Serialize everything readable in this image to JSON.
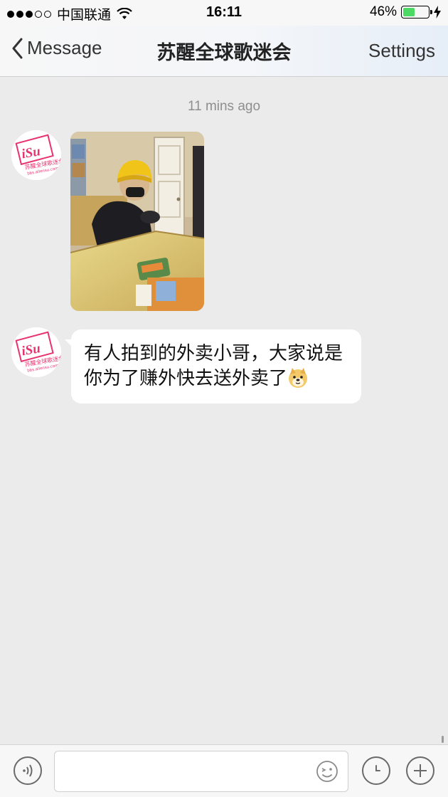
{
  "status_bar": {
    "carrier": "中国联通",
    "time": "16:11",
    "battery_percent_label": "46%",
    "battery_level": 0.46
  },
  "nav": {
    "back_label": "Message",
    "title": "苏醒全球歌迷会",
    "settings_label": "Settings"
  },
  "chat": {
    "timestamp": "11 mins ago",
    "messages": [
      {
        "type": "image",
        "sender_avatar": {
          "logo_text": "iSu",
          "sub_text": "苏醒全球歌迷会",
          "url_text": "bbs.allensu.com"
        }
      },
      {
        "type": "text",
        "sender_avatar": {
          "logo_text": "iSu",
          "sub_text": "苏醒全球歌迷会",
          "url_text": "bbs.allensu.com"
        },
        "line1": "有人拍到的外卖小哥，大家说是",
        "line2": "你为了赚外快去送外卖了",
        "emoji": "doge-emoji"
      }
    ]
  },
  "input_bar": {
    "text_value": "",
    "voice_icon": "voice-icon",
    "emoji_icon": "smiley-icon",
    "history_icon": "clock-icon",
    "more_icon": "plus-icon"
  },
  "colors": {
    "accent_logo": "#e8336f",
    "background": "#ebebeb",
    "battery": "#4cd964"
  }
}
